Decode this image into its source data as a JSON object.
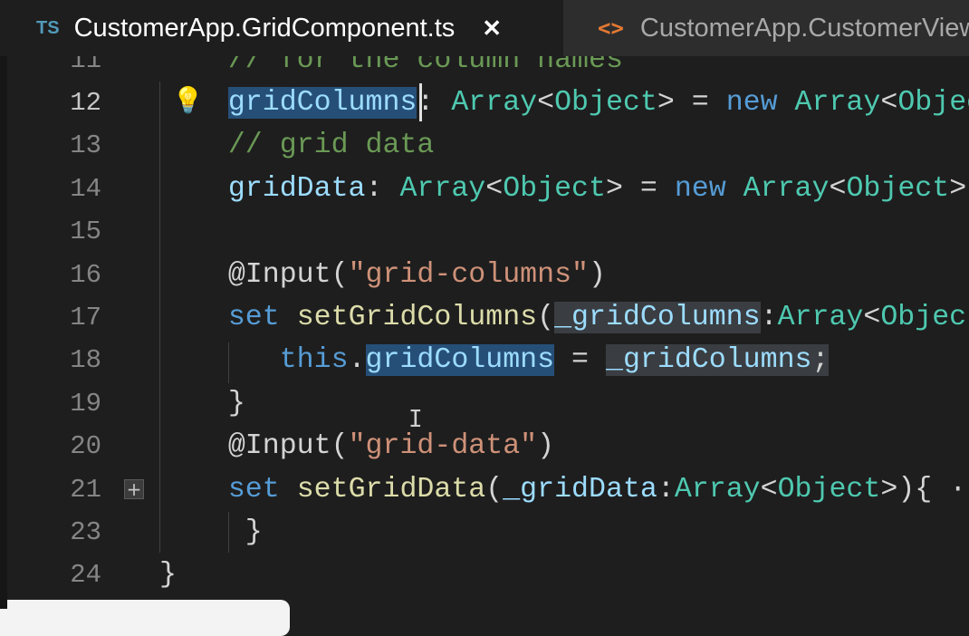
{
  "tabs": [
    {
      "icon": "TS",
      "label": "CustomerApp.GridComponent.ts",
      "close": "✕",
      "active": true
    },
    {
      "icon": "<>",
      "label": "CustomerApp.CustomerViewModel.html",
      "active": false
    }
  ],
  "current_line": 12,
  "lines": [
    {
      "n": 11,
      "indent": 4,
      "tokens": [
        {
          "t": "// for the column names",
          "c": "comment"
        }
      ]
    },
    {
      "n": 12,
      "indent": 4,
      "tokens": [
        {
          "t": "gridColumns",
          "c": "var",
          "h": "selection"
        },
        {
          "t": ": ",
          "c": "punc"
        },
        {
          "t": "Array",
          "c": "type"
        },
        {
          "t": "<",
          "c": "punc"
        },
        {
          "t": "Object",
          "c": "type"
        },
        {
          "t": "> = ",
          "c": "punc"
        },
        {
          "t": "new ",
          "c": "kw"
        },
        {
          "t": "Array",
          "c": "type"
        },
        {
          "t": "<",
          "c": "punc"
        },
        {
          "t": "Object",
          "c": "type"
        },
        {
          "t": ">();",
          "c": "punc"
        }
      ]
    },
    {
      "n": 13,
      "indent": 4,
      "tokens": [
        {
          "t": "// grid data",
          "c": "comment"
        }
      ]
    },
    {
      "n": 14,
      "indent": 4,
      "tokens": [
        {
          "t": "gridData",
          "c": "var"
        },
        {
          "t": ": ",
          "c": "punc"
        },
        {
          "t": "Array",
          "c": "type"
        },
        {
          "t": "<",
          "c": "punc"
        },
        {
          "t": "Object",
          "c": "type"
        },
        {
          "t": "> = ",
          "c": "punc"
        },
        {
          "t": "new ",
          "c": "kw"
        },
        {
          "t": "Array",
          "c": "type"
        },
        {
          "t": "<",
          "c": "punc"
        },
        {
          "t": "Object",
          "c": "type"
        },
        {
          "t": ">();",
          "c": "punc"
        }
      ]
    },
    {
      "n": 15,
      "indent": 4,
      "tokens": []
    },
    {
      "n": 16,
      "indent": 4,
      "tokens": [
        {
          "t": "@Input(",
          "c": "deco"
        },
        {
          "t": "\"grid-columns\"",
          "c": "str"
        },
        {
          "t": ")",
          "c": "punc"
        }
      ]
    },
    {
      "n": 17,
      "indent": 4,
      "tokens": [
        {
          "t": "set ",
          "c": "kw"
        },
        {
          "t": "setGridColumns",
          "c": "fn"
        },
        {
          "t": "(",
          "c": "punc"
        },
        {
          "t": "_gridColumns",
          "c": "var",
          "h": "occurrence"
        },
        {
          "t": ":",
          "c": "punc"
        },
        {
          "t": "Array",
          "c": "type"
        },
        {
          "t": "<",
          "c": "punc"
        },
        {
          "t": "Object",
          "c": "type"
        },
        {
          "t": ">){",
          "c": "punc"
        }
      ]
    },
    {
      "n": 18,
      "indent": 7,
      "tokens": [
        {
          "t": "this",
          "c": "kw"
        },
        {
          "t": ".",
          "c": "punc"
        },
        {
          "t": "gridColumns",
          "c": "var",
          "h": "selection"
        },
        {
          "t": " = ",
          "c": "punc"
        },
        {
          "t": "_gridColumns",
          "c": "var",
          "h": "occurrence"
        },
        {
          "t": ";",
          "c": "punc",
          "h": "occurrence"
        }
      ]
    },
    {
      "n": 19,
      "indent": 4,
      "tokens": [
        {
          "t": "}",
          "c": "punc"
        }
      ]
    },
    {
      "n": 20,
      "indent": 4,
      "tokens": [
        {
          "t": "@Input(",
          "c": "deco"
        },
        {
          "t": "\"grid-data\"",
          "c": "str"
        },
        {
          "t": ")",
          "c": "punc"
        }
      ]
    },
    {
      "n": 21,
      "indent": 4,
      "tokens": [
        {
          "t": "set ",
          "c": "kw"
        },
        {
          "t": "setGridData",
          "c": "fn"
        },
        {
          "t": "(",
          "c": "punc"
        },
        {
          "t": "_gridData",
          "c": "var"
        },
        {
          "t": ":",
          "c": "punc"
        },
        {
          "t": "Array",
          "c": "type"
        },
        {
          "t": "<",
          "c": "punc"
        },
        {
          "t": "Object",
          "c": "type"
        },
        {
          "t": ">){",
          "c": "punc"
        },
        {
          "t": " ···",
          "c": "punc"
        }
      ]
    },
    {
      "n": 23,
      "indent": 5,
      "tokens": [
        {
          "t": "}",
          "c": "punc"
        }
      ]
    },
    {
      "n": 24,
      "indent": 0,
      "tokens": [
        {
          "t": "}",
          "c": "punc"
        }
      ]
    }
  ],
  "fold_icon": "+",
  "mouse_cursor": "I"
}
